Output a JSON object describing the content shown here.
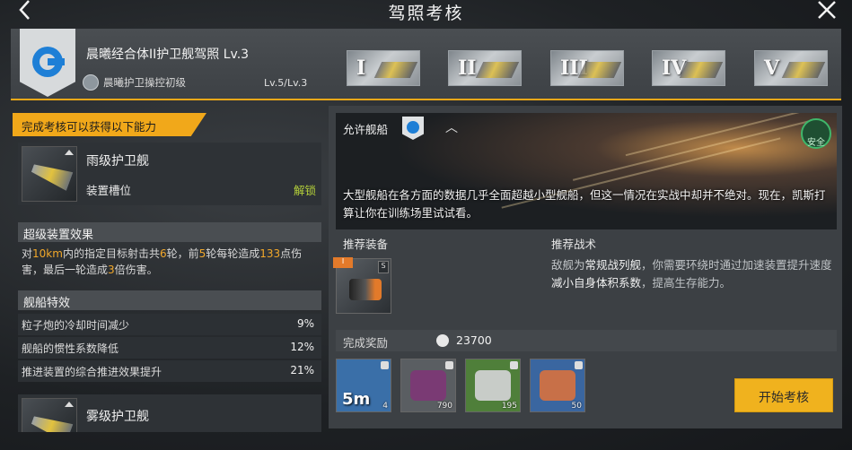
{
  "page": {
    "title": "驾照考核"
  },
  "nav": {
    "back_icon": "chevron-left-icon",
    "close_icon": "close-icon"
  },
  "header": {
    "license_name": "晨曦经合体II护卫舰驾照 Lv.3",
    "skill_name": "晨曦护卫操控初级",
    "level_text": "Lv.5/Lv.3",
    "tiers": [
      "I",
      "II",
      "III",
      "IV",
      "V"
    ],
    "accent_color": "#f0a818"
  },
  "left": {
    "banner": "完成考核可以获得以下能力",
    "ship1": {
      "name": "雨级护卫舰",
      "slot_label": "装置槽位",
      "unlock_label": "解锁"
    },
    "super_effect_title": "超级装置效果",
    "super_effect": {
      "p1": "对",
      "h1": "10km",
      "p2": "内的指定目标射击共",
      "h2": "6",
      "p3": "轮，前",
      "h3": "5",
      "p4": "轮每轮造成",
      "h4": "133",
      "p5": "点伤害，最后一轮造成",
      "h5": "3",
      "p6": "倍伤害。"
    },
    "traits_title": "舰船特效",
    "traits": [
      {
        "label": "粒子炮的冷却时间减少",
        "value": "9%"
      },
      {
        "label": "舰船的惯性系数降低",
        "value": "12%"
      },
      {
        "label": "推进装置的综合推进效果提升",
        "value": "21%"
      }
    ],
    "ship2": {
      "name": "雾级护卫舰"
    }
  },
  "right": {
    "allowed_label": "允许舰船",
    "safe_label": "安全",
    "mission_text": "大型舰船在各方面的数据几乎全面超越小型舰船，但这一情况在实战中却并不绝对。现在，凯斯打算让你在训练场里试试看。",
    "rec_gear_label": "推荐装备",
    "gear_badge": "I",
    "gear_grade": "S",
    "rec_tactic_label": "推荐战术",
    "tactic": {
      "p1": "敌舰为",
      "h1": "常规战列舰",
      "p2": "，你需要环绕时通过加速装置提升速度",
      "h2": "减小自身体积系数",
      "p3": "，提高生存能力。"
    },
    "reward_label": "完成奖励",
    "reward_amount": "23700",
    "items": [
      {
        "label": "5m",
        "count": "4",
        "color": "#3a6fa8"
      },
      {
        "label": "",
        "count": "790",
        "color": "#7a3a74"
      },
      {
        "label": "",
        "count": "195",
        "color": "#4f7f3a"
      },
      {
        "label": "",
        "count": "50",
        "color": "#3a66a0"
      }
    ],
    "start_button": "开始考核"
  }
}
